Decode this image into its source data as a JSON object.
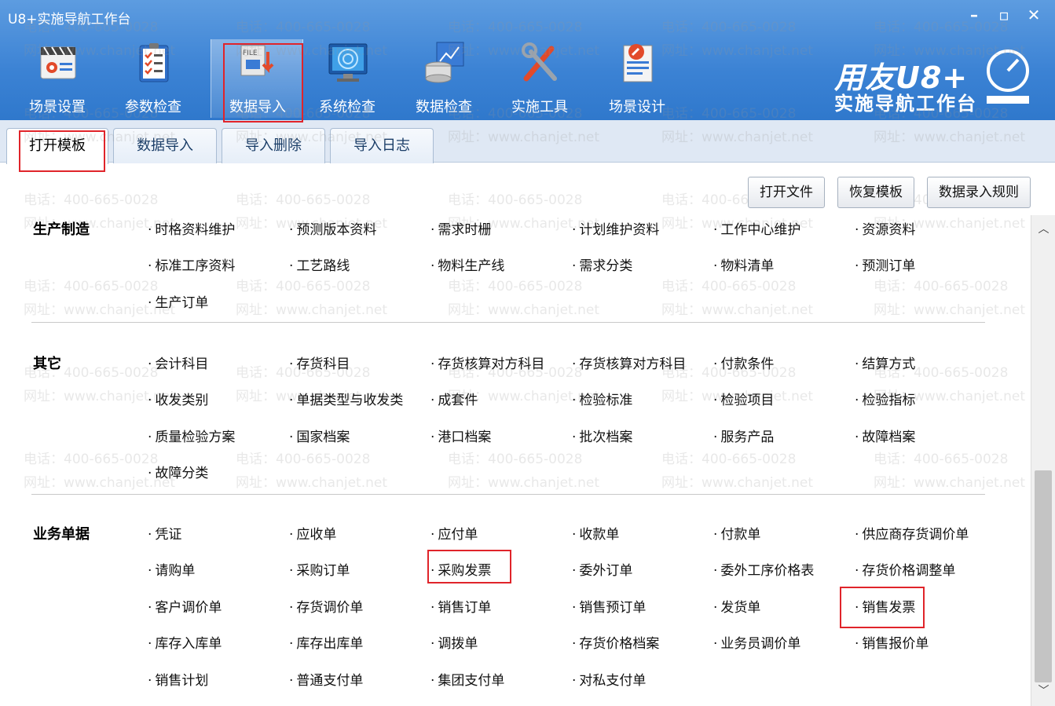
{
  "window": {
    "title": "U8+实施导航工作台"
  },
  "toolbar": [
    {
      "label": "场景设置",
      "icon": "scene-settings-icon"
    },
    {
      "label": "参数检查",
      "icon": "checklist-icon"
    },
    {
      "label": "数据导入",
      "icon": "file-import-icon"
    },
    {
      "label": "系统检查",
      "icon": "monitor-radar-icon"
    },
    {
      "label": "数据检查",
      "icon": "database-chart-icon"
    },
    {
      "label": "实施工具",
      "icon": "tools-icon"
    },
    {
      "label": "场景设计",
      "icon": "design-doc-icon"
    }
  ],
  "brand": {
    "line1": "用友U8+",
    "line2": "实施导航工作台"
  },
  "subtabs": [
    "打开模板",
    "数据导入",
    "导入删除",
    "导入日志"
  ],
  "actions": [
    "打开文件",
    "恢复模板",
    "数据录入规则"
  ],
  "watermark": {
    "phone": "电话：400-665-0028",
    "site": "网址：www.chanjet.net"
  },
  "sections": [
    {
      "title": "生产制造",
      "items": [
        "时格资料维护",
        "预测版本资料",
        "需求时栅",
        "计划维护资料",
        "工作中心维护",
        "资源资料",
        "标准工序资料",
        "工艺路线",
        "物料生产线",
        "需求分类",
        "物料清单",
        "预测订单",
        "生产订单"
      ]
    },
    {
      "title": "其它",
      "items": [
        "会计科目",
        "存货科目",
        "存货核算对方科目",
        "存货核算对方科目",
        "付款条件",
        "结算方式",
        "收发类别",
        "单据类型与收发类",
        "成套件",
        "检验标准",
        "检验项目",
        "检验指标",
        "质量检验方案",
        "国家档案",
        "港口档案",
        "批次档案",
        "服务产品",
        "故障档案",
        "故障分类"
      ]
    },
    {
      "title": "业务单据",
      "items": [
        "凭证",
        "应收单",
        "应付单",
        "收款单",
        "付款单",
        "供应商存货调价单",
        "请购单",
        "采购订单",
        "采购发票",
        "委外订单",
        "委外工序价格表",
        "存货价格调整单",
        "客户调价单",
        "存货调价单",
        "销售订单",
        "销售预订单",
        "发货单",
        "销售发票",
        "库存入库单",
        "库存出库单",
        "调拨单",
        "存货价格档案",
        "业务员调价单",
        "销售报价单",
        "销售计划",
        "普通支付单",
        "集团支付单",
        "对私支付单"
      ]
    }
  ]
}
